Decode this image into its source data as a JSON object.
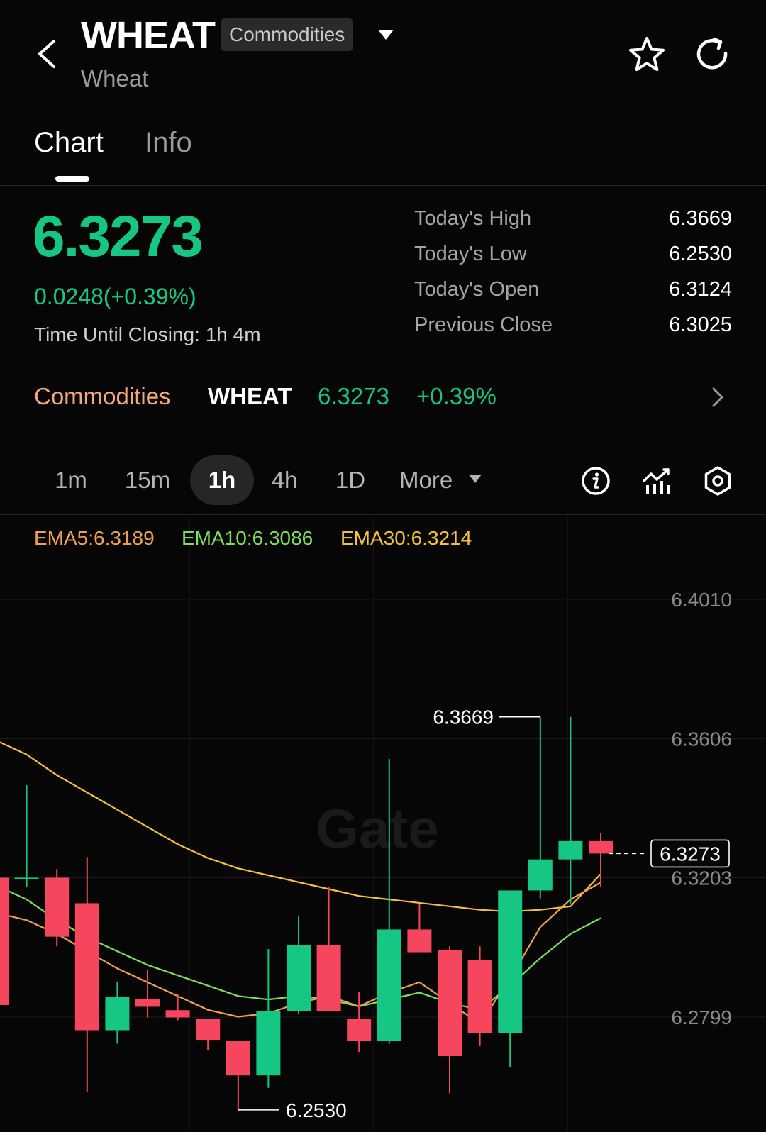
{
  "header": {
    "symbol": "WHEAT",
    "market_badge": "Commodities",
    "name": "Wheat"
  },
  "tabs": [
    {
      "label": "Chart",
      "active": true
    },
    {
      "label": "Info",
      "active": false
    }
  ],
  "quote": {
    "price": "6.3273",
    "change": "0.0248(+0.39%)",
    "closing_label": "Time Until Closing:",
    "closing_value": "1h 4m"
  },
  "stats": [
    {
      "label": "Today's High",
      "value": "6.3669"
    },
    {
      "label": "Today's Low",
      "value": "6.2530"
    },
    {
      "label": "Today's Open",
      "value": "6.3124"
    },
    {
      "label": "Previous Close",
      "value": "6.3025"
    }
  ],
  "ticker": {
    "market": "Commodities",
    "symbol": "WHEAT",
    "price": "6.3273",
    "change_pct": "+0.39%"
  },
  "intervals": {
    "items": [
      "1m",
      "15m",
      "1h",
      "4h",
      "1D"
    ],
    "selected": "1h",
    "more_label": "More"
  },
  "ema": {
    "ema5": "EMA5:6.3189",
    "ema10": "EMA10:6.3086",
    "ema30": "EMA30:6.3214"
  },
  "colors": {
    "up": "#16c784",
    "down": "#f6465d",
    "ema5": "#f0a050",
    "ema10": "#7ee05a",
    "ema30": "#f5c040",
    "accent_market": "#f5a97a"
  },
  "icons": {
    "back": "chevron-left-icon",
    "badge_caret": "caret-down-icon",
    "star": "star-icon",
    "refresh": "refresh-icon",
    "ticker_chevron": "chevron-right-icon",
    "info": "info-icon",
    "indicators": "indicator-chart-icon",
    "settings": "settings-hexagon-icon"
  },
  "chart_data": {
    "type": "candlestick",
    "y_ticks": [
      6.401,
      6.3606,
      6.3203,
      6.2799
    ],
    "ylim": [
      6.2466,
      6.417
    ],
    "high_label": "6.3669",
    "low_label": "6.2530",
    "last_price_label": "6.3273",
    "last_price": 6.3273,
    "watermark": "Gate",
    "candles": [
      {
        "o": 6.3203,
        "h": 6.3203,
        "l": 6.2834,
        "c": 6.2834
      },
      {
        "o": 6.3199,
        "h": 6.3471,
        "l": 6.3176,
        "c": 6.3203
      },
      {
        "o": 6.3203,
        "h": 6.3228,
        "l": 6.3004,
        "c": 6.3032
      },
      {
        "o": 6.3129,
        "h": 6.3263,
        "l": 6.2581,
        "c": 6.2761
      },
      {
        "o": 6.2761,
        "h": 6.2901,
        "l": 6.2722,
        "c": 6.2857
      },
      {
        "o": 6.2851,
        "h": 6.2936,
        "l": 6.2798,
        "c": 6.2829
      },
      {
        "o": 6.2819,
        "h": 6.2865,
        "l": 6.279,
        "c": 6.2798
      },
      {
        "o": 6.2794,
        "h": 6.2794,
        "l": 6.2704,
        "c": 6.2733
      },
      {
        "o": 6.273,
        "h": 6.273,
        "l": 6.253,
        "c": 6.263
      },
      {
        "o": 6.263,
        "h": 6.2996,
        "l": 6.2594,
        "c": 6.2817
      },
      {
        "o": 6.2817,
        "h": 6.309,
        "l": 6.2807,
        "c": 6.3008
      },
      {
        "o": 6.3008,
        "h": 6.3175,
        "l": 6.2817,
        "c": 6.2817
      },
      {
        "o": 6.2794,
        "h": 6.2872,
        "l": 6.2698,
        "c": 6.273
      },
      {
        "o": 6.273,
        "h": 6.3547,
        "l": 6.2722,
        "c": 6.3053
      },
      {
        "o": 6.3053,
        "h": 6.3127,
        "l": 6.2996,
        "c": 6.2987
      },
      {
        "o": 6.2993,
        "h": 6.3004,
        "l": 6.2578,
        "c": 6.2686
      },
      {
        "o": 6.2964,
        "h": 6.3004,
        "l": 6.2715,
        "c": 6.2752
      },
      {
        "o": 6.2752,
        "h": 6.3151,
        "l": 6.2653,
        "c": 6.3166
      },
      {
        "o": 6.3166,
        "h": 6.3669,
        "l": 6.3143,
        "c": 6.3256
      },
      {
        "o": 6.3256,
        "h": 6.3669,
        "l": 6.3128,
        "c": 6.3309
      },
      {
        "o": 6.3309,
        "h": 6.3332,
        "l": 6.3176,
        "c": 6.3273
      }
    ],
    "ema5_series": [
      6.3101,
      6.308,
      6.304,
      6.299,
      6.294,
      6.29,
      6.286,
      6.282,
      6.28,
      6.281,
      6.284,
      6.286,
      6.283,
      6.287,
      6.29,
      6.284,
      6.278,
      6.291,
      6.306,
      6.314,
      6.3189
    ],
    "ema10_series": [
      6.318,
      6.314,
      6.308,
      6.303,
      6.299,
      6.295,
      6.292,
      6.289,
      6.286,
      6.285,
      6.286,
      6.285,
      6.283,
      6.285,
      6.287,
      6.284,
      6.282,
      6.289,
      6.297,
      6.304,
      6.3086
    ],
    "ema30_series": [
      6.36,
      6.356,
      6.35,
      6.345,
      6.34,
      6.335,
      6.33,
      6.326,
      6.323,
      6.321,
      6.319,
      6.317,
      6.315,
      6.314,
      6.313,
      6.312,
      6.311,
      6.3105,
      6.311,
      6.312,
      6.3214
    ]
  }
}
